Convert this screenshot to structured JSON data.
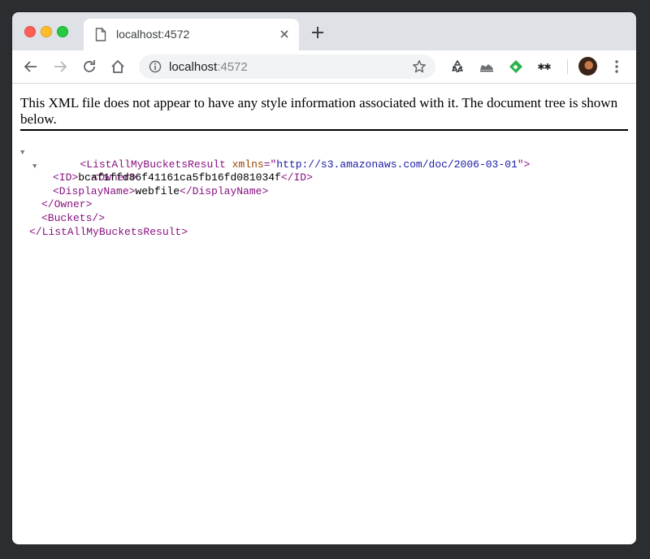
{
  "tab": {
    "title": "localhost:4572"
  },
  "omnibox": {
    "host": "localhost",
    "port": ":4572"
  },
  "notice": {
    "text": "This XML file does not appear to have any style information associated with it. The document tree is shown below."
  },
  "xml": {
    "root_open": "<ListAllMyBucketsResult",
    "root_attr_name": "xmlns",
    "root_attr_eq": "=\"",
    "root_attr_value": "http://s3.amazonaws.com/doc/2006-03-01",
    "root_attr_close": "\">",
    "owner_open": "<Owner>",
    "id_open": "<ID>",
    "id_value": "bcaf1ffd86f41161ca5fb16fd081034f",
    "id_close": "</ID>",
    "displayname_open": "<DisplayName>",
    "displayname_value": "webfile",
    "displayname_close": "</DisplayName>",
    "owner_close": "</Owner>",
    "buckets": "<Buckets/>",
    "root_close": "</ListAllMyBucketsResult>"
  },
  "icons": {
    "toolbar": [
      "back-icon",
      "forward-icon",
      "reload-icon",
      "home-icon",
      "star-icon",
      "recycle-extension-icon",
      "shoe-extension-icon",
      "feedly-extension-icon",
      "asterisk-extension-icon",
      "menu-icon"
    ]
  }
}
